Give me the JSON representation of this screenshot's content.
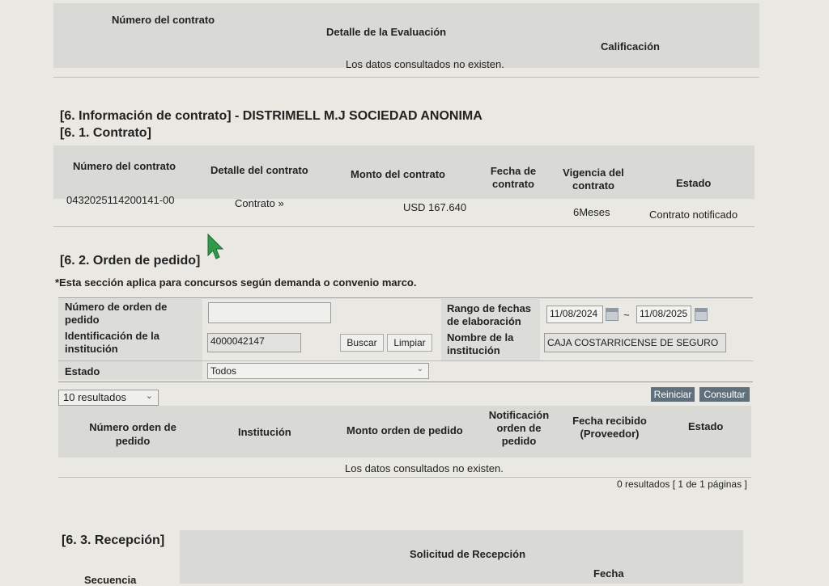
{
  "top_table": {
    "headers": [
      "Número del contrato",
      "Detalle de la Evaluación",
      "Calificación"
    ],
    "empty_message": "Los datos consultados no existen."
  },
  "section6": {
    "title": "[6. Información de contrato] - DISTRIMELL M.J SOCIEDAD ANONIMA",
    "sub1_title": "[6. 1. Contrato]"
  },
  "contract_table": {
    "headers": [
      "Número del contrato",
      "Detalle del contrato",
      "Monto del contrato",
      "Fecha de contrato",
      "Vigencia del contrato",
      "Estado"
    ],
    "row": {
      "number": "0432025114200141-00",
      "detail": "Contrato »",
      "amount": "USD 167.640",
      "date": "",
      "validity": "6Meses",
      "status": "Contrato notificado"
    }
  },
  "orders": {
    "title": "[6. 2. Orden de pedido]",
    "note": "*Esta sección aplica para concursos según demanda o convenio marco.",
    "form": {
      "order_number_label": "Número de orden de pedido",
      "order_number_value": "",
      "date_range_label": "Rango de fechas de elaboración",
      "date_from": "11/08/2024",
      "date_sep": "~",
      "date_to": "11/08/2025",
      "institution_id_label": "Identificación de la institución",
      "institution_id_value": "4000042147",
      "search_button": "Buscar",
      "clear_button": "Limpiar",
      "institution_name_label": "Nombre de la institución",
      "institution_name_value": "CAJA COSTARRICENSE DE SEGURO",
      "status_label": "Estado",
      "status_value": "Todos"
    },
    "results_select": "10 resultados",
    "reset_button": "Reiniciar",
    "query_button": "Consultar",
    "table": {
      "headers": [
        "Número orden de pedido",
        "Institución",
        "Monto orden de pedido",
        "Notificación orden de pedido",
        "Fecha recibido (Proveedor)",
        "Estado"
      ],
      "empty_message": "Los datos consultados no existen."
    },
    "pagination": "0 resultados [ 1 de 1 páginas ]"
  },
  "reception": {
    "title": "[6. 3. Recepción]",
    "headers": [
      "Solicitud de Recepción",
      "Secuencia",
      "Fecha"
    ]
  }
}
